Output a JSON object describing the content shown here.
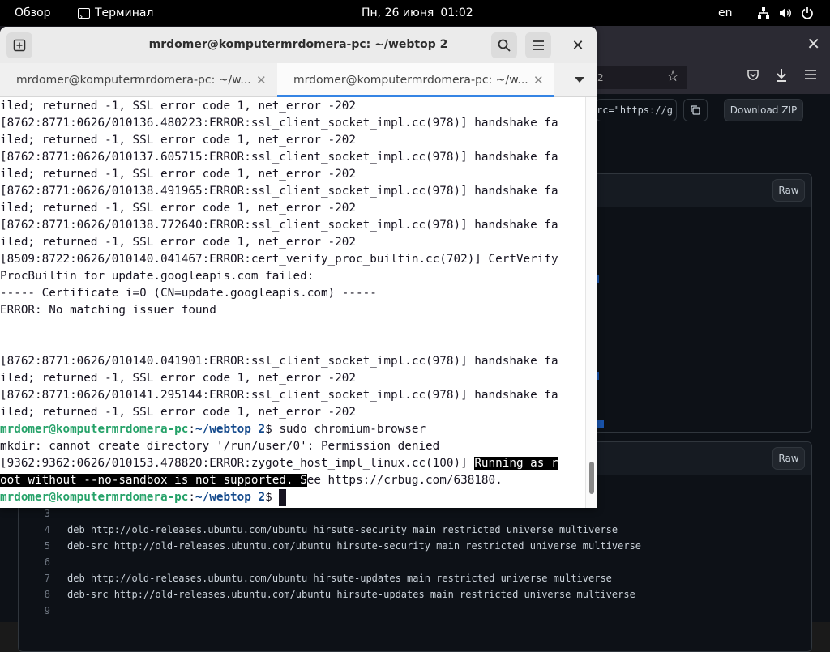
{
  "topbar": {
    "overview": "Обзор",
    "app_name": "Терминал",
    "date": "Пн, 26 июня",
    "time": "01:02",
    "lang": "en"
  },
  "terminal": {
    "title": "mrdomer@komputermrdomera-pc: ~/webtop 2",
    "tabs": [
      {
        "label": "mrdomer@komputermrdomera-pc: ~/w...",
        "active": false
      },
      {
        "label": "mrdomer@komputermrdomera-pc: ~/w...",
        "active": true
      }
    ],
    "lines": [
      "iled; returned -1, SSL error code 1, net_error -202",
      "[8762:8771:0626/010136.480223:ERROR:ssl_client_socket_impl.cc(978)] handshake fa",
      "iled; returned -1, SSL error code 1, net_error -202",
      "[8762:8771:0626/010137.605715:ERROR:ssl_client_socket_impl.cc(978)] handshake fa",
      "iled; returned -1, SSL error code 1, net_error -202",
      "[8762:8771:0626/010138.491965:ERROR:ssl_client_socket_impl.cc(978)] handshake fa",
      "iled; returned -1, SSL error code 1, net_error -202",
      "[8762:8771:0626/010138.772640:ERROR:ssl_client_socket_impl.cc(978)] handshake fa",
      "iled; returned -1, SSL error code 1, net_error -202",
      "[8509:8722:0626/010140.041467:ERROR:cert_verify_proc_builtin.cc(702)] CertVerify",
      "ProcBuiltin for update.googleapis.com failed:",
      "----- Certificate i=0 (CN=update.googleapis.com) -----",
      "ERROR: No matching issuer found",
      "",
      "",
      "[8762:8771:0626/010140.041901:ERROR:ssl_client_socket_impl.cc(978)] handshake fa",
      "iled; returned -1, SSL error code 1, net_error -202",
      "[8762:8771:0626/010141.295144:ERROR:ssl_client_socket_impl.cc(978)] handshake fa",
      "iled; returned -1, SSL error code 1, net_error -202"
    ],
    "prompt_user": "mrdomer@komputermrdomera-pc",
    "prompt_sep": ":",
    "prompt_path": "~/webtop 2",
    "prompt_dollar": "$ ",
    "command": "sudo chromium-browser",
    "mkdir_line": "mkdir: cannot create directory '/run/user/0': Permission denied",
    "zygote_prefix": "[9362:9362:0626/010153.478820:ERROR:zygote_host_impl_linux.cc(100)] ",
    "zygote_sel_first": "R",
    "zygote_sel_rest": "unning as r",
    "sandbox_sel": "oot without --no-sandbox is not supported. S",
    "sandbox_rest": "ee https://crbug.com/638180."
  },
  "browser": {
    "url_fragment": "2",
    "clone_fragment": "rc=\"https://g",
    "download_zip": "Download ZIP",
    "raw_label": "Raw",
    "code_lines": [
      {
        "num": "3",
        "text": ""
      },
      {
        "num": "4",
        "text": "deb http://old-releases.ubuntu.com/ubuntu hirsute-security main restricted universe multiverse"
      },
      {
        "num": "5",
        "text": "deb-src http://old-releases.ubuntu.com/ubuntu hirsute-security main restricted universe multiverse"
      },
      {
        "num": "6",
        "text": ""
      },
      {
        "num": "7",
        "text": "deb http://old-releases.ubuntu.com/ubuntu hirsute-updates main restricted universe multiverse"
      },
      {
        "num": "8",
        "text": "deb-src http://old-releases.ubuntu.com/ubuntu hirsute-updates main restricted universe multiverse"
      },
      {
        "num": "9",
        "text": ""
      }
    ]
  },
  "icons": {
    "new_tab": "plus-square-icon",
    "search": "search-icon",
    "menu": "hamburger-menu-icon",
    "close": "close-icon",
    "network": "network-icon",
    "volume": "volume-icon",
    "power": "power-icon"
  },
  "colors": {
    "prompt_user": "#26a269",
    "prompt_path": "#12488b",
    "tab_indicator": "#3584e4",
    "topbar_bg": "#000000"
  }
}
